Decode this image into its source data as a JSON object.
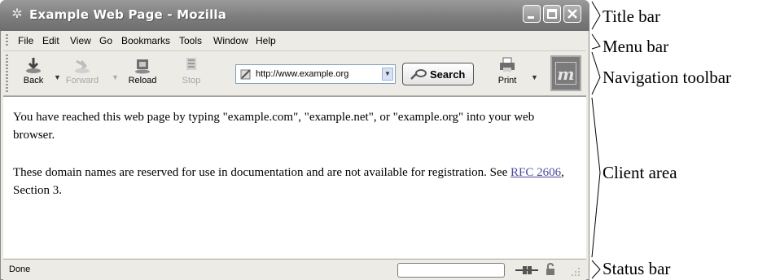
{
  "window": {
    "title": "Example Web Page - Mozilla",
    "logo_icon": "mozilla-star-icon",
    "controls": [
      "minimize-icon",
      "maximize-icon",
      "close-icon"
    ]
  },
  "menu": {
    "items": [
      "File",
      "Edit",
      "View",
      "Go",
      "Bookmarks",
      "Tools",
      "Window",
      "Help"
    ]
  },
  "toolbar": {
    "back_label": "Back",
    "forward_label": "Forward",
    "reload_label": "Reload",
    "stop_label": "Stop",
    "url": "http://www.example.org",
    "search_label": "Search",
    "print_label": "Print"
  },
  "content": {
    "para1": "You have reached this web page by typing \"example.com\", \"example.net\", or \"example.org\" into your web browser.",
    "para2_before": "These domain names are reserved for use in documentation and are not available for registration. See ",
    "para2_link": "RFC 2606",
    "para2_after": ", Section 3."
  },
  "status": {
    "text": "Done"
  },
  "annotations": {
    "title_bar": "Title bar",
    "menu_bar": "Menu bar",
    "navigation_toolbar": "Navigation toolbar",
    "client_area": "Client area",
    "status_bar": "Status bar"
  },
  "colors": {
    "title_bar": "#7d7d7d",
    "chrome": "#ecebe5",
    "link": "#4b4b9b"
  }
}
